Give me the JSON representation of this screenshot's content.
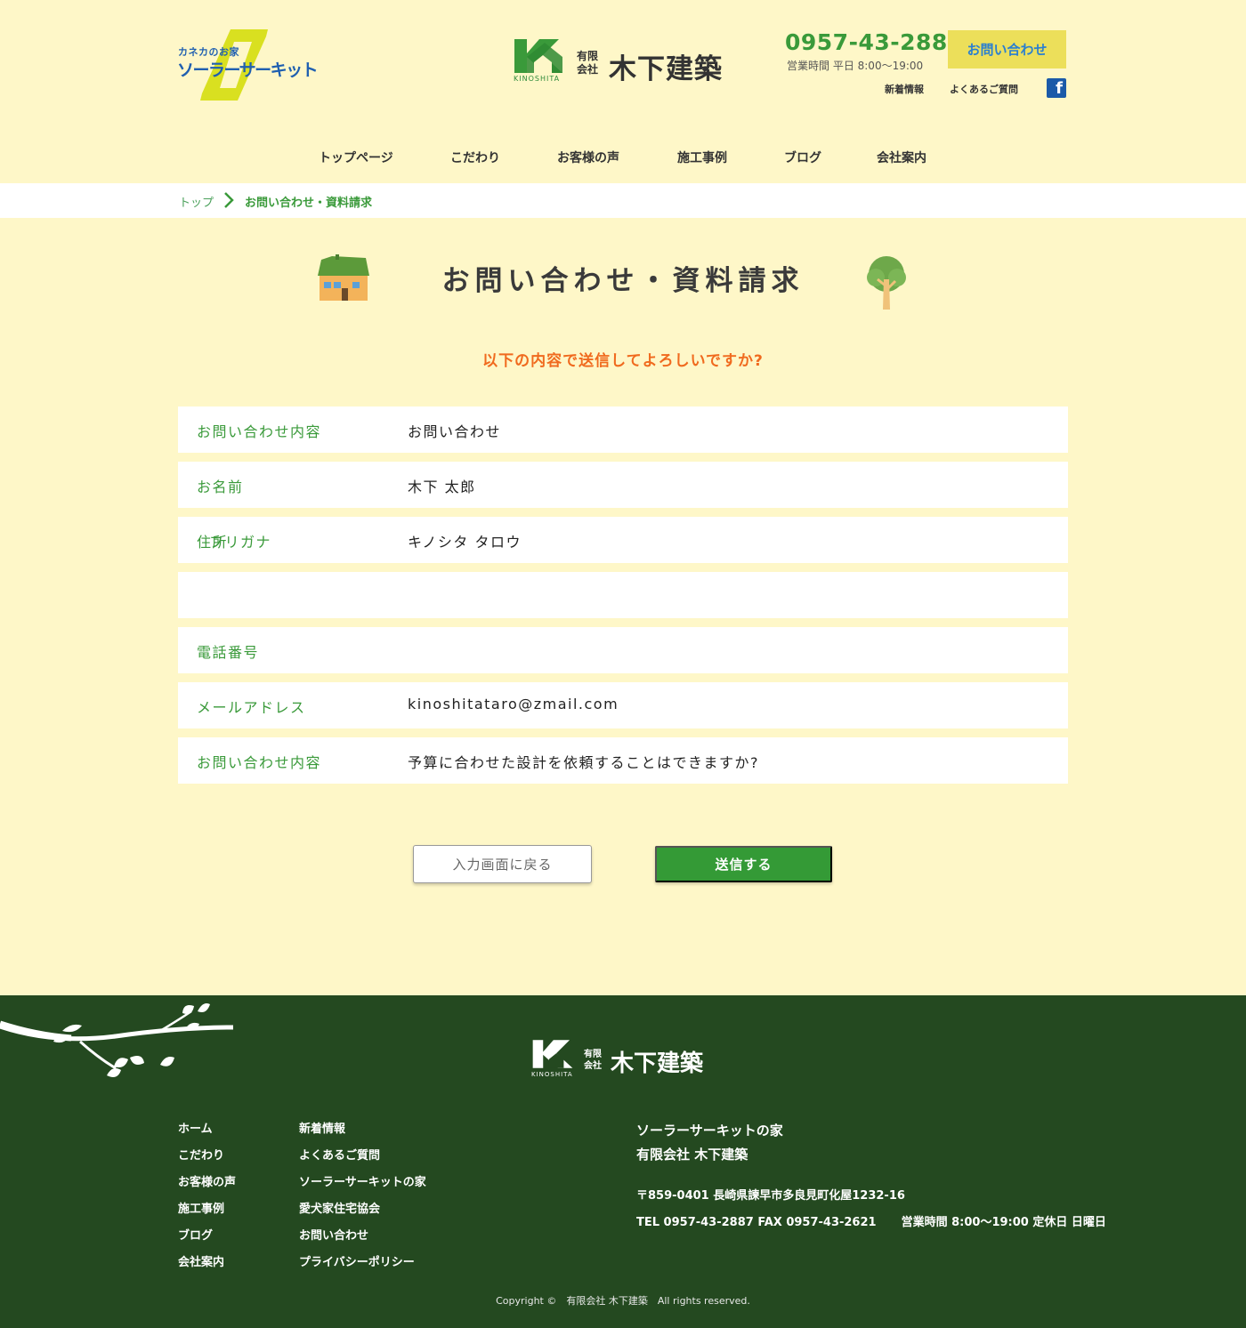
{
  "header": {
    "solar_logo": {
      "tag": "カネカのお家",
      "name": "ソーラーサーキット"
    },
    "company_logo": {
      "mark_text": "KINOSHITA",
      "type_line1": "有限",
      "type_line2": "会社",
      "name": "木下建築"
    },
    "phone": "0957-43-2887",
    "hours": "営業時間 平日 8:00〜19:00",
    "contact_button": "お問い合わせ",
    "links": {
      "news": "新着情報",
      "faq": "よくあるご質問"
    },
    "facebook_icon": "facebook-icon"
  },
  "nav": [
    {
      "label": "トップページ"
    },
    {
      "label": "こだわり"
    },
    {
      "label": "お客様の声"
    },
    {
      "label": "施工事例"
    },
    {
      "label": "ブログ"
    },
    {
      "label": "会社案内"
    }
  ],
  "breadcrumb": {
    "top": "トップ",
    "current": "お問い合わせ・資料請求"
  },
  "page": {
    "title": "お問い合わせ・資料請求",
    "confirm_message": "以下の内容で送信してよろしいですか?"
  },
  "form_rows": [
    {
      "label": "お問い合わせ内容",
      "value": "お問い合わせ"
    },
    {
      "label": "お名前",
      "value": "木下 太郎"
    },
    {
      "label": "住所",
      "label_overlap": "フリガナ",
      "value": "キノシタ タロウ"
    },
    {
      "label": "",
      "value": ""
    },
    {
      "label": "電話番号",
      "value": ""
    },
    {
      "label": "メールアドレス",
      "value": "kinoshitataro@zmail.com"
    },
    {
      "label": "お問い合わせ内容",
      "value": "予算に合わせた設計を依頼することはできますか?"
    }
  ],
  "buttons": {
    "back": "入力画面に戻る",
    "submit": "送信する"
  },
  "footer": {
    "logo": {
      "mark_text": "KINOSHITA",
      "type_line1": "有限",
      "type_line2": "会社",
      "name": "木下建築"
    },
    "nav_col1": [
      "ホーム",
      "こだわり",
      "お客様の声",
      "施工事例",
      "ブログ",
      "会社案内"
    ],
    "nav_col2": [
      "新着情報",
      "よくあるご質問",
      "ソーラーサーキットの家",
      "愛犬家住宅協会",
      "お問い合わせ",
      "プライバシーポリシー"
    ],
    "info": {
      "line1": "ソーラーサーキットの家",
      "line2": "有限会社 木下建築",
      "address": "〒859-0401 長崎県諫早市多良見町化屋1232-16",
      "tel": "TEL 0957-43-2887 FAX 0957-43-2621",
      "hours": "営業時間 8:00〜19:00 定休日 日曜日"
    },
    "copyright": "Copyright ©　有限会社 木下建築　All rights reserved."
  },
  "colors": {
    "background": "#fef7c8",
    "green": "#3a9a3a",
    "orange": "#f06a1e",
    "footer": "#244920",
    "contact_button": "#ecdf5a"
  }
}
